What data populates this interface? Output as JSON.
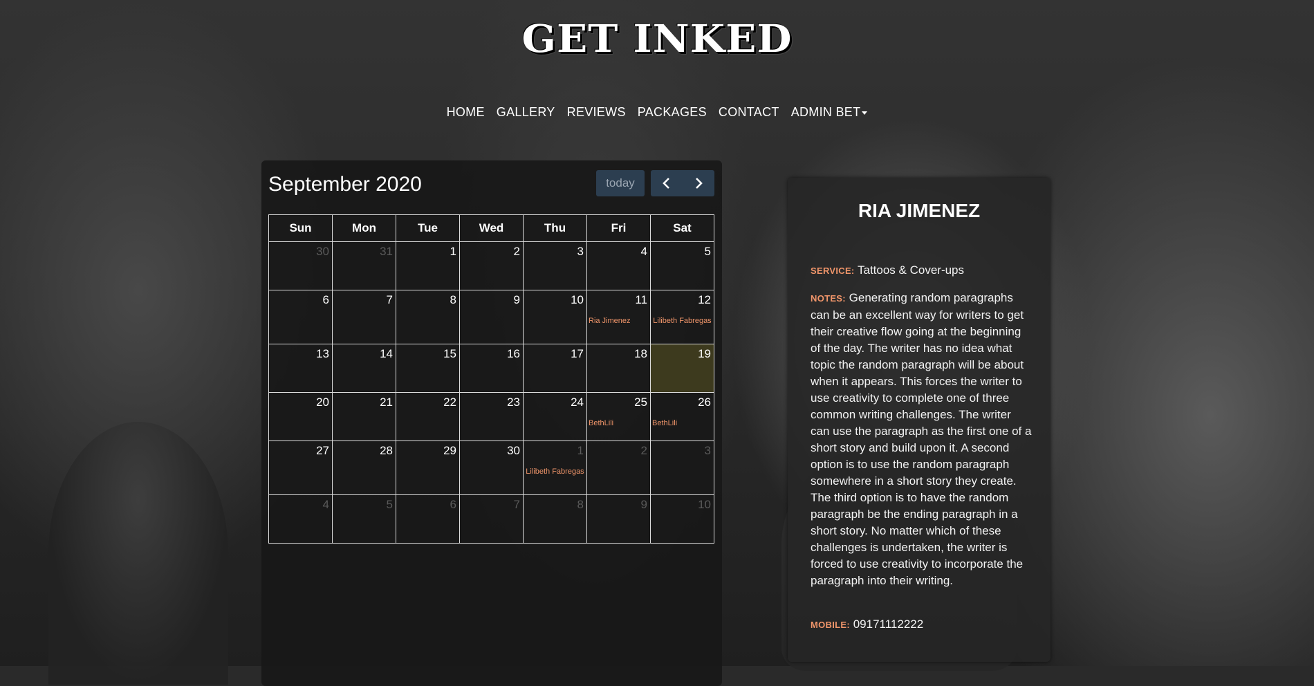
{
  "brand": {
    "logo_text": "GET INKED"
  },
  "nav": {
    "items": [
      "HOME",
      "GALLERY",
      "REVIEWS",
      "PACKAGES",
      "CONTACT",
      "ADMIN BET"
    ]
  },
  "calendar": {
    "title": "September 2020",
    "today_label": "today",
    "weekdays": [
      "Sun",
      "Mon",
      "Tue",
      "Wed",
      "Thu",
      "Fri",
      "Sat"
    ],
    "weeks": [
      [
        {
          "d": "30",
          "other": true
        },
        {
          "d": "31",
          "other": true
        },
        {
          "d": "1"
        },
        {
          "d": "2"
        },
        {
          "d": "3"
        },
        {
          "d": "4"
        },
        {
          "d": "5"
        }
      ],
      [
        {
          "d": "6"
        },
        {
          "d": "7"
        },
        {
          "d": "8"
        },
        {
          "d": "9"
        },
        {
          "d": "10"
        },
        {
          "d": "11",
          "event": "Ria Jimenez"
        },
        {
          "d": "12",
          "event": "Lilibeth Fabregas",
          "center": true
        }
      ],
      [
        {
          "d": "13"
        },
        {
          "d": "14"
        },
        {
          "d": "15"
        },
        {
          "d": "16"
        },
        {
          "d": "17"
        },
        {
          "d": "18"
        },
        {
          "d": "19",
          "today": true
        }
      ],
      [
        {
          "d": "20"
        },
        {
          "d": "21"
        },
        {
          "d": "22"
        },
        {
          "d": "23"
        },
        {
          "d": "24"
        },
        {
          "d": "25",
          "event": "BethLili"
        },
        {
          "d": "26",
          "event": "BethLili"
        }
      ],
      [
        {
          "d": "27"
        },
        {
          "d": "28"
        },
        {
          "d": "29"
        },
        {
          "d": "30"
        },
        {
          "d": "1",
          "other": true,
          "event": "Lilibeth Fabregas",
          "center": true
        },
        {
          "d": "2",
          "other": true
        },
        {
          "d": "3",
          "other": true
        }
      ],
      [
        {
          "d": "4",
          "other": true
        },
        {
          "d": "5",
          "other": true
        },
        {
          "d": "6",
          "other": true
        },
        {
          "d": "7",
          "other": true
        },
        {
          "d": "8",
          "other": true
        },
        {
          "d": "9",
          "other": true
        },
        {
          "d": "10",
          "other": true
        }
      ]
    ]
  },
  "profile": {
    "name": "RIA JIMENEZ",
    "service_label": "SERVICE:",
    "service": "Tattoos & Cover-ups",
    "notes_label": "NOTES:",
    "notes": "Generating random paragraphs can be an excellent way for writers to get their creative flow going at the beginning of the day. The writer has no idea what topic the random paragraph will be about when it appears. This forces the writer to use creativity to complete one of three common writing challenges. The writer can use the paragraph as the first one of a short story and build upon it. A second option is to use the random paragraph somewhere in a short story they create. The third option is to have the random paragraph be the ending paragraph in a short story. No matter which of these challenges is undertaken, the writer is forced to use creativity to incorporate the paragraph into their writing.",
    "mobile_label": "MOBILE:",
    "mobile": "09171112222"
  },
  "colors": {
    "accent": "#f0956a",
    "button": "#2c3e50",
    "today_highlight": "#3d3a1e"
  }
}
